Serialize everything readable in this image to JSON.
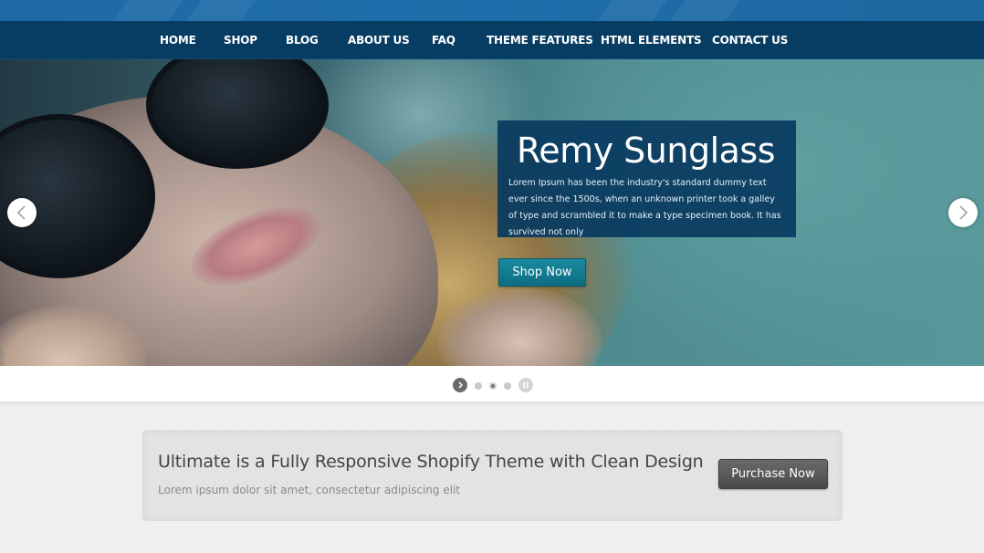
{
  "nav": {
    "items": [
      {
        "label": "HOME"
      },
      {
        "label": "SHOP"
      },
      {
        "label": "BLOG"
      },
      {
        "label": "ABOUT US"
      },
      {
        "label": "FAQ"
      },
      {
        "label": "THEME FEATURES"
      },
      {
        "label": "HTML ELEMENTS"
      },
      {
        "label": "CONTACT US"
      }
    ]
  },
  "slider": {
    "title": "Remy Sunglass",
    "text": "Lorem Ipsum has been the industry's standard dummy text ever since the 1500s, when an unknown printer took a galley of type and scrambled it to make a type specimen book. It has survived not only",
    "button_label": "Shop Now",
    "prev_icon": "chevron-left-icon",
    "next_icon": "chevron-right-icon",
    "slide_count": 3,
    "current_slide": 2
  },
  "promo": {
    "title": "Ultimate is a Fully Responsive Shopify Theme with Clean Design",
    "subtitle": "Lorem ipsum dolor sit amet, consectetur adipiscing elit",
    "button_label": "Purchase Now"
  },
  "colors": {
    "nav_bg": "#083d63",
    "top_band": "#1e6aa5",
    "caption_bg": "#083a60",
    "shop_button": "#1a8aa0",
    "purchase_button": "#5a5a5a"
  }
}
